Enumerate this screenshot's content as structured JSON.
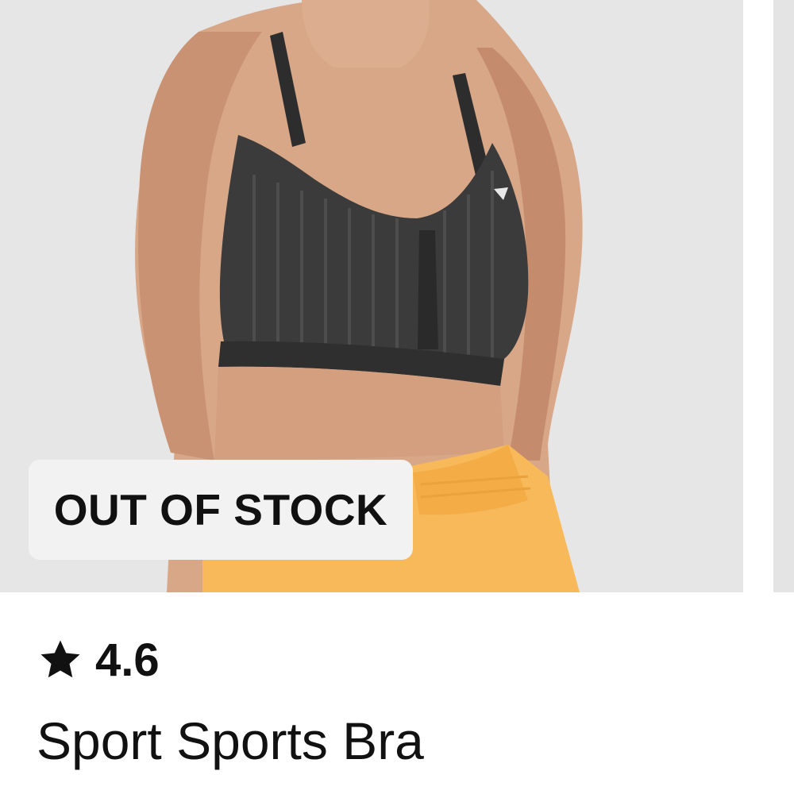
{
  "product": {
    "badge": "OUT OF STOCK",
    "rating": "4.6",
    "title": "Sport Sports Bra",
    "image_icon": "product-photo",
    "rating_icon": "star-icon"
  },
  "colors": {
    "image_background": "#e6e6e6",
    "badge_background": "#f2f2f2",
    "text": "#111111",
    "garment_top": "#3b3b3c",
    "garment_bottom": "#f8b95a"
  }
}
